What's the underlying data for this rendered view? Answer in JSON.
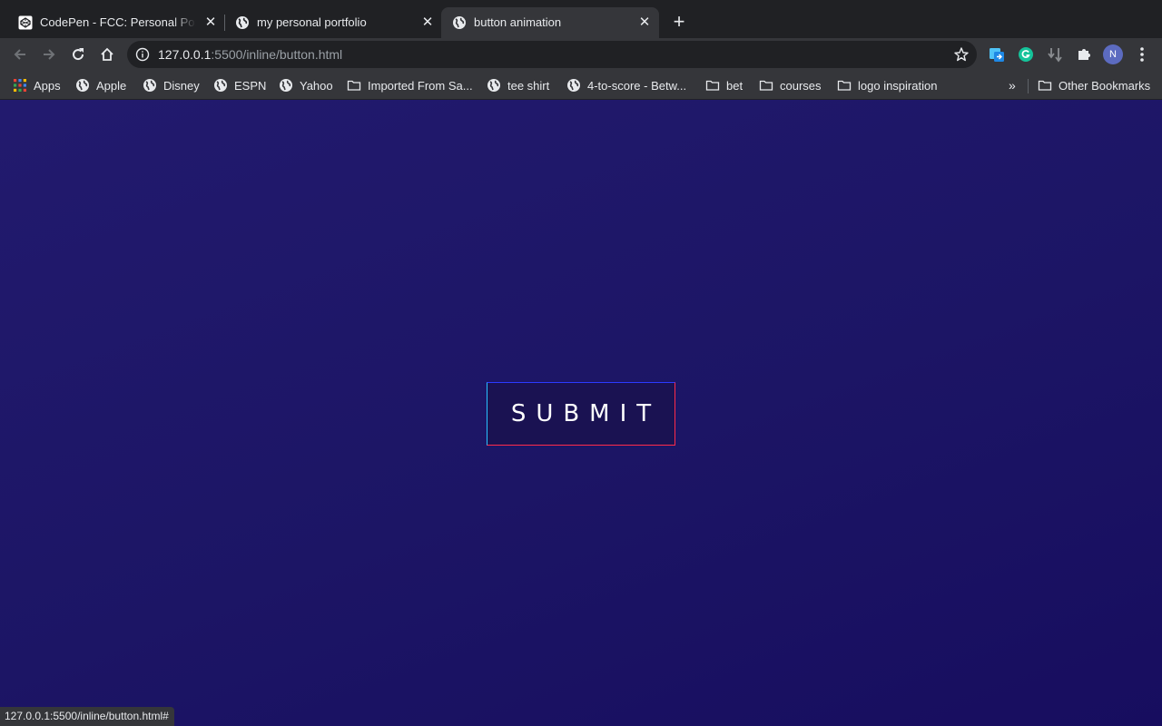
{
  "tabs": [
    {
      "title": "CodePen - FCC: Personal Portfolio",
      "favicon": "codepen-icon",
      "active": false
    },
    {
      "title": "my personal portfolio",
      "favicon": "globe-icon",
      "active": false
    },
    {
      "title": "button animation",
      "favicon": "globe-icon",
      "active": true
    }
  ],
  "toolbar": {
    "url_host": "127.0.0.1",
    "url_rest": ":5500/inline/button.html"
  },
  "bookmarks": {
    "items": [
      {
        "label": "Apps",
        "icon": "apps-grid-icon"
      },
      {
        "label": "Apple",
        "icon": "globe-icon"
      },
      {
        "label": "Disney",
        "icon": "globe-icon"
      },
      {
        "label": "ESPN",
        "icon": "globe-icon"
      },
      {
        "label": "Yahoo",
        "icon": "globe-icon"
      },
      {
        "label": "Imported From Sa...",
        "icon": "folder-icon"
      },
      {
        "label": "tee shirt",
        "icon": "globe-icon"
      },
      {
        "label": "4-to-score - Betw...",
        "icon": "globe-icon"
      },
      {
        "label": "bet",
        "icon": "folder-icon"
      },
      {
        "label": "courses",
        "icon": "folder-icon"
      },
      {
        "label": "logo inspiration",
        "icon": "folder-icon"
      }
    ],
    "overflow": "»",
    "other": "Other Bookmarks"
  },
  "page": {
    "button_label": "SUBMIT"
  },
  "status_bar": {
    "text": "127.0.0.1:5500/inline/button.html#"
  },
  "profile": {
    "initial": "N"
  },
  "colors": {
    "page_bg_top": "#221a6e",
    "page_bg_bottom": "#170d5f",
    "button_bg": "#1a1252",
    "border_blue": "#2b3aff",
    "border_cyan": "#28c2ff",
    "border_red": "#ff2b4a"
  }
}
